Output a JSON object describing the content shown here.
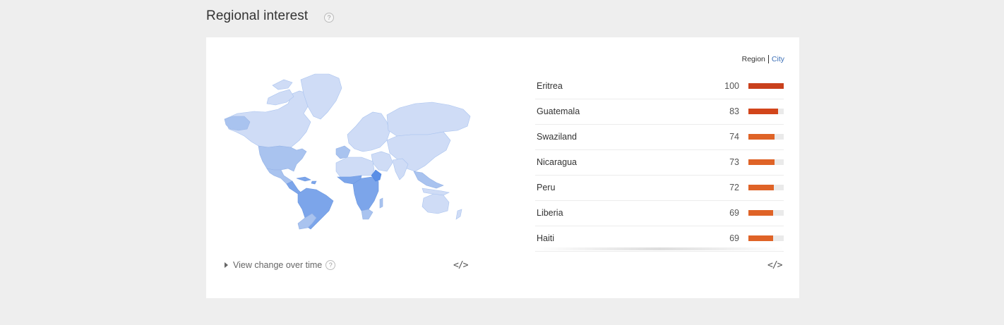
{
  "header": {
    "title": "Regional interest",
    "help": "?"
  },
  "toggle": {
    "region": "Region",
    "city": "City"
  },
  "regions": [
    {
      "name": "Eritrea",
      "value": 100,
      "color": "#c9401c"
    },
    {
      "name": "Guatemala",
      "value": 83,
      "color": "#d2451b"
    },
    {
      "name": "Swaziland",
      "value": 74,
      "color": "#df6327"
    },
    {
      "name": "Nicaragua",
      "value": 73,
      "color": "#df6327"
    },
    {
      "name": "Peru",
      "value": 72,
      "color": "#df6327"
    },
    {
      "name": "Liberia",
      "value": 69,
      "color": "#df6327"
    },
    {
      "name": "Haiti",
      "value": 69,
      "color": "#df6327"
    }
  ],
  "footer": {
    "view_change": "View change over time",
    "help": "?",
    "embed": "</>"
  },
  "colors": {
    "map_light": "#cfdcf6",
    "map_mid": "#a9c3ef",
    "map_dark": "#7ca5ea",
    "bar_top": "#c9401c",
    "bar_other": "#df6327"
  }
}
